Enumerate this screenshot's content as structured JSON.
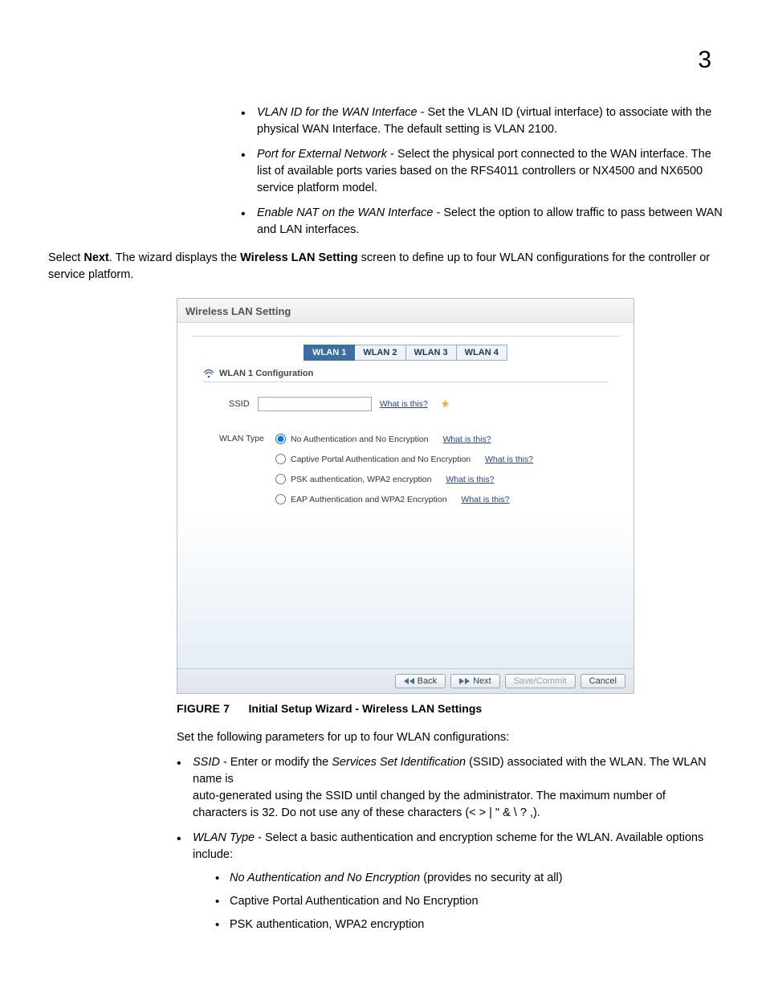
{
  "page_number": "3",
  "intro_bullets": [
    {
      "label": "VLAN ID for the WAN Interface",
      "text": " - Set the VLAN ID (virtual interface) to associate with the physical WAN Interface. The default setting is VLAN 2100."
    },
    {
      "label": "Port for External Network",
      "text": " - Select the physical port connected to the WAN interface. The list of available ports varies based on the RFS4011 controllers or NX4500 and NX6500 service platform model."
    },
    {
      "label": "Enable NAT on the WAN Interface",
      "text": " - Select the option to allow traffic to pass between WAN and LAN interfaces."
    }
  ],
  "para_select_next": {
    "pre": "Select ",
    "next": "Next",
    "mid": ". The wizard displays the ",
    "wls": "Wireless LAN Setting",
    "post": " screen to define up to four WLAN configurations for the controller or service platform."
  },
  "screenshot": {
    "title": "Wireless LAN Setting",
    "tabs": [
      "WLAN 1",
      "WLAN 2",
      "WLAN 3",
      "WLAN 4"
    ],
    "conf_header": "WLAN 1 Configuration",
    "ssid_label": "SSID",
    "what_is_this": "What is this?",
    "wlan_type_label": "WLAN Type",
    "options": [
      "No Authentication and No Encryption",
      "Captive Portal Authentication and No Encryption",
      "PSK authentication, WPA2 encryption",
      "EAP Authentication and WPA2 Encryption"
    ],
    "buttons": {
      "back": "Back",
      "next": "Next",
      "save": "Save/Commit",
      "cancel": "Cancel"
    }
  },
  "caption": {
    "fig": "FIGURE 7",
    "text": "Initial Setup Wizard - Wireless LAN Settings"
  },
  "after_para": "Set the following parameters for up to four WLAN configurations:",
  "after_bullets": [
    {
      "label": "SSID",
      "line1_a": " - Enter or modify the ",
      "line1_i": "Services Set Identification",
      "line1_b": " (SSID) associated with the WLAN. The WLAN name is",
      "line2": "auto-generated using the SSID until changed by the administrator. The maximum number of characters is 32. Do not use any of these characters (< > | \" & \\ ? ,)."
    },
    {
      "label": "WLAN Type",
      "line1": " - Select a basic authentication and encryption scheme for the WLAN. Available options include:",
      "subs": [
        {
          "i": "No Authentication and No Encryption",
          "rest": " (provides no security at all)"
        },
        {
          "plain": "Captive Portal Authentication and No Encryption"
        },
        {
          "plain": "PSK authentication, WPA2 encryption"
        }
      ]
    }
  ]
}
